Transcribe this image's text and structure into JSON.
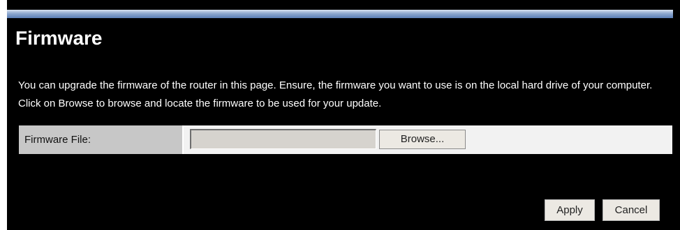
{
  "page": {
    "title": "Firmware",
    "description": "You can upgrade the firmware of the router in this page. Ensure, the firmware you want to use is on the local hard drive of your computer. Click on Browse to browse and locate the firmware to be used for your update."
  },
  "form": {
    "firmware_file_label": "Firmware File:",
    "firmware_file_value": "",
    "browse_label": "Browse..."
  },
  "actions": {
    "apply_label": "Apply",
    "cancel_label": "Cancel"
  },
  "colors": {
    "background": "#000000",
    "header_bar": "#8fa8cf",
    "label_cell": "#c7c7c7",
    "row_background": "#f2f2f2"
  }
}
